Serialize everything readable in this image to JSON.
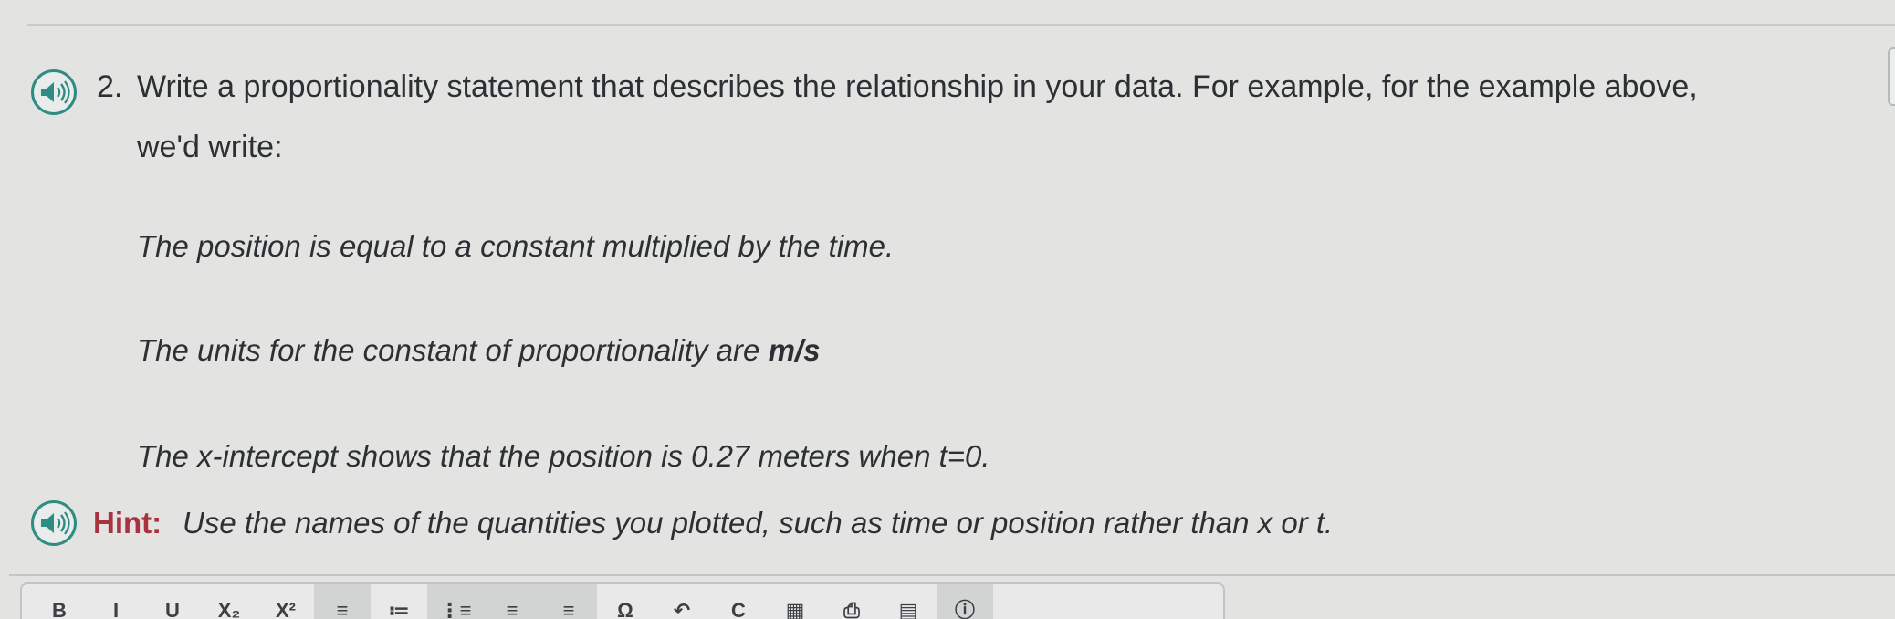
{
  "question": {
    "number": "2.",
    "text": "Write a proportionality statement that describes the relationship in your data. For example, for the example above, we'd write:",
    "examples": {
      "statement": "The position is equal to a constant multiplied by the time.",
      "units_prefix": "The units for the constant of proportionality are",
      "units_value": "m/s",
      "intercept": "The x-intercept shows that the position is 0.27 meters when t=0."
    }
  },
  "hint": {
    "label": "Hint:",
    "text": "Use the names of the quantities you plotted, such as time or position rather than x or t."
  },
  "icons": {
    "question_audio": "speaker-icon",
    "hint_audio": "speaker-icon"
  },
  "toolbar": {
    "buttons": [
      "B",
      "I",
      "U",
      "X₂",
      "X²",
      "≡",
      "≔",
      "⋮≡",
      "≡",
      "≡",
      "Ω",
      "↶",
      "C",
      "▦",
      "⎙",
      "▤",
      "ⓘ"
    ]
  },
  "colors": {
    "accent_teal": "#2f8c83",
    "hint_red": "#a8323d",
    "text": "#2c2f33",
    "background": "#e3e4e2"
  }
}
